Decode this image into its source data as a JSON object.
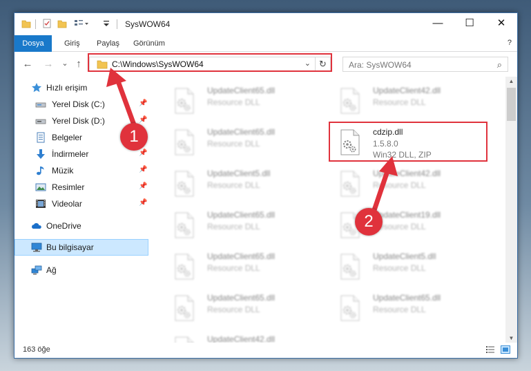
{
  "window": {
    "title": "SysWOW64",
    "min_glyph": "—",
    "max_glyph": "☐",
    "close_glyph": "✕"
  },
  "ribbon": {
    "tabs": [
      "Dosya",
      "Giriş",
      "Paylaş",
      "Görünüm"
    ],
    "file_tab_color": "#1979ca",
    "help_glyph": "?"
  },
  "nav": {
    "back_glyph": "←",
    "forward_glyph": "→",
    "recent_glyph": "⌄",
    "up_glyph": "↑"
  },
  "address": {
    "path": "C:\\Windows\\SysWOW64",
    "chevron": "⌄",
    "refresh_glyph": "↻"
  },
  "search": {
    "placeholder": "Ara: SysWOW64",
    "icon": "⌕"
  },
  "sidebar": {
    "items": [
      {
        "label": "Hızlı erişim",
        "icon": "star-icon",
        "pinned": false
      },
      {
        "label": "Yerel Disk (C:)",
        "icon": "drive-icon",
        "pinned": true
      },
      {
        "label": "Yerel Disk (D:)",
        "icon": "drive-icon",
        "pinned": true
      },
      {
        "label": "Belgeler",
        "icon": "documents-icon",
        "pinned": true
      },
      {
        "label": "İndirmeler",
        "icon": "download-icon",
        "pinned": true
      },
      {
        "label": "Müzik",
        "icon": "music-icon",
        "pinned": true
      },
      {
        "label": "Resimler",
        "icon": "pictures-icon",
        "pinned": true
      },
      {
        "label": "Videolar",
        "icon": "videos-icon",
        "pinned": true
      },
      {
        "label": "OneDrive",
        "icon": "cloud-icon",
        "pinned": false
      },
      {
        "label": "Bu bilgisayar",
        "icon": "computer-icon",
        "pinned": false,
        "selected": true
      },
      {
        "label": "Ağ",
        "icon": "network-icon",
        "pinned": false
      }
    ],
    "pin_glyph": "📌"
  },
  "files": {
    "left_column": [
      {
        "name": "UpdateClient65.dll",
        "type": "Resource DLL"
      },
      {
        "name": "UpdateClient65.dll",
        "type": "Resource DLL"
      },
      {
        "name": "UpdateClient5.dll",
        "type": "Resource DLL"
      },
      {
        "name": "UpdateClient65.dll",
        "type": "Resource DLL"
      },
      {
        "name": "UpdateClient65.dll",
        "type": "Resource DLL"
      },
      {
        "name": "UpdateClient65.dll",
        "type": "Resource DLL"
      },
      {
        "name": "UpdateClient42.dll",
        "type": "Resource DLL"
      }
    ],
    "right_column": [
      {
        "name": "UpdateClient42.dll",
        "type": "Resource DLL"
      },
      {
        "name": "UpdateClient42.dll",
        "type": "Resource DLL"
      },
      {
        "name": "UpdateClient19.dll",
        "type": "Resource DLL"
      },
      {
        "name": "UpdateClient5.dll",
        "type": "Resource DLL"
      },
      {
        "name": "UpdateClient65.dll",
        "type": "Resource DLL"
      }
    ],
    "highlighted": {
      "name": "cdzip.dll",
      "version": "1.5.8.0",
      "type": "Win32 DLL, ZIP"
    }
  },
  "status": {
    "count": "163 öğe"
  },
  "callouts": {
    "one": "1",
    "two": "2",
    "color": "#e0323c"
  },
  "scrollbar": {
    "up_glyph": "▲",
    "down_glyph": "▼"
  }
}
